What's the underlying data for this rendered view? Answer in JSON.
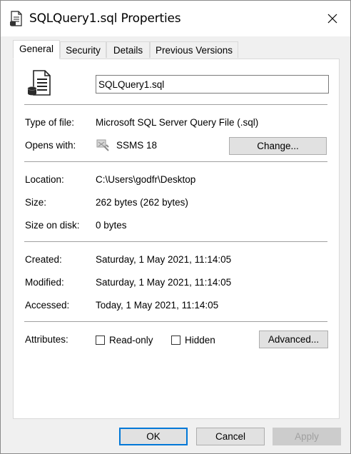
{
  "window": {
    "title": "SQLQuery1.sql Properties",
    "title_icon": "document-icon",
    "close_icon": "close-icon"
  },
  "tabs": [
    {
      "label": "General",
      "active": true
    },
    {
      "label": "Security",
      "active": false
    },
    {
      "label": "Details",
      "active": false
    },
    {
      "label": "Previous Versions",
      "active": false
    }
  ],
  "general": {
    "file_icon": "sql-file-icon",
    "file_name": "SQLQuery1.sql",
    "type_label": "Type of file:",
    "type_value": "Microsoft SQL Server Query File (.sql)",
    "opens_label": "Opens with:",
    "opens_icon": "ssms-app-icon",
    "opens_value": "SSMS 18",
    "change_button": "Change...",
    "location_label": "Location:",
    "location_value": "C:\\Users\\godfr\\Desktop",
    "size_label": "Size:",
    "size_value": "262 bytes (262 bytes)",
    "size_disk_label": "Size on disk:",
    "size_disk_value": "0 bytes",
    "created_label": "Created:",
    "created_value": "Saturday, 1 May 2021, 11:14:05",
    "modified_label": "Modified:",
    "modified_value": "Saturday, 1 May 2021, 11:14:05",
    "accessed_label": "Accessed:",
    "accessed_value": "Today, 1 May 2021, 11:14:05",
    "attributes_label": "Attributes:",
    "readonly_label": "Read-only",
    "readonly_checked": false,
    "hidden_label": "Hidden",
    "hidden_checked": false,
    "advanced_button": "Advanced..."
  },
  "footer": {
    "ok": "OK",
    "cancel": "Cancel",
    "apply": "Apply"
  },
  "colors": {
    "accent": "#0078d7",
    "dialog_bg": "#f0f0f0",
    "panel_bg": "#ffffff"
  }
}
